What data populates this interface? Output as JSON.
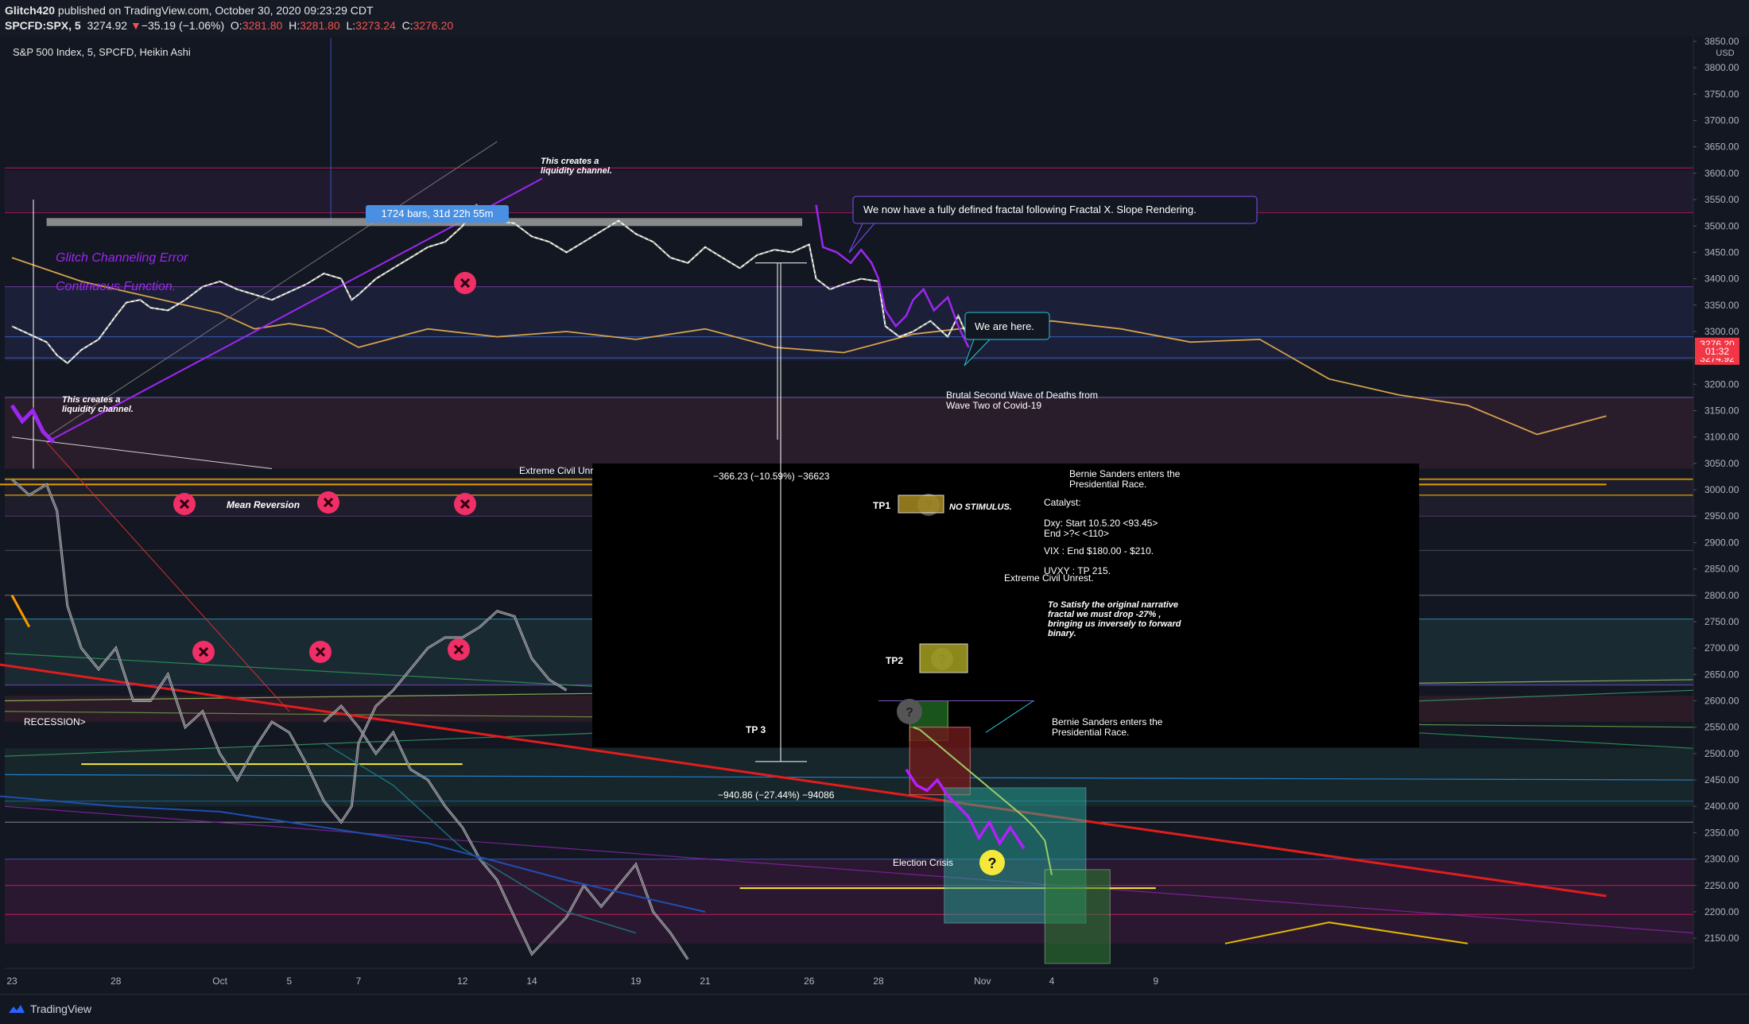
{
  "header": {
    "author": "Glitch420",
    "published_text": "published on TradingView.com, October 30, 2020 09:23:29 CDT",
    "symbol": "SPCFD:SPX, 5",
    "last": "3274.92",
    "change": "−35.19 (−1.06%)",
    "open_label": "O:",
    "open": "3281.80",
    "high_label": "H:",
    "high": "3281.80",
    "low_label": "L:",
    "low": "3273.24",
    "close_label": "C:",
    "close": "3276.20"
  },
  "footer": {
    "brand": "TradingView"
  },
  "colors": {
    "background": "#131722",
    "candles": "#f0f0f0",
    "purple": "#9c27f0",
    "orange": "#d4a24c",
    "red_line": "#e11d1d",
    "yellow": "#f5e83a",
    "marker": "#ef2f66"
  },
  "chart_data": {
    "type": "line",
    "title": "S&P 500 Index, 5, SPCFD, Heikin Ashi",
    "currency": "USD",
    "y_ticks": [
      3850,
      3800,
      3750,
      3700,
      3650,
      3600,
      3550,
      3500,
      3450,
      3400,
      3350,
      3300,
      3250,
      3200,
      3150,
      3100,
      3050,
      3000,
      2950,
      2900,
      2850,
      2800,
      2750,
      2700,
      2650,
      2600,
      2550,
      2500,
      2450,
      2400,
      2350,
      2300,
      2250,
      2200,
      2150
    ],
    "ylim": [
      2135,
      3870
    ],
    "x_ticks": [
      {
        "label": "23",
        "day": 0
      },
      {
        "label": "28",
        "day": 3
      },
      {
        "label": "Oct",
        "day": 6
      },
      {
        "label": "5",
        "day": 8
      },
      {
        "label": "7",
        "day": 10
      },
      {
        "label": "12",
        "day": 13
      },
      {
        "label": "14",
        "day": 15
      },
      {
        "label": "19",
        "day": 18
      },
      {
        "label": "21",
        "day": 20
      },
      {
        "label": "26",
        "day": 23
      },
      {
        "label": "28",
        "day": 25
      },
      {
        "label": "Nov",
        "day": 28
      },
      {
        "label": "4",
        "day": 30
      },
      {
        "label": "9",
        "day": 33
      }
    ],
    "price_badges": [
      {
        "text": "3276.20",
        "value": 3276.2
      },
      {
        "text": "3274.92",
        "value": 3249
      },
      {
        "text": "01:32",
        "value": 3262
      }
    ],
    "series": [
      {
        "name": "",
        "kind": "candles",
        "points": [
          [
            0,
            3310
          ],
          [
            0.5,
            3295
          ],
          [
            1,
            3280
          ],
          [
            1.3,
            3255
          ],
          [
            1.6,
            3240
          ],
          [
            2,
            3265
          ],
          [
            2.5,
            3285
          ],
          [
            3,
            3330
          ],
          [
            3.3,
            3355
          ],
          [
            3.7,
            3360
          ],
          [
            4,
            3345
          ],
          [
            4.5,
            3340
          ],
          [
            5,
            3360
          ],
          [
            5.5,
            3385
          ],
          [
            6,
            3395
          ],
          [
            6.5,
            3380
          ],
          [
            7,
            3370
          ],
          [
            7.5,
            3360
          ],
          [
            8,
            3375
          ],
          [
            8.5,
            3390
          ],
          [
            9,
            3410
          ],
          [
            9.5,
            3400
          ],
          [
            9.8,
            3360
          ],
          [
            10,
            3370
          ],
          [
            10.5,
            3400
          ],
          [
            11,
            3420
          ],
          [
            11.5,
            3440
          ],
          [
            12,
            3460
          ],
          [
            12.5,
            3470
          ],
          [
            13,
            3500
          ],
          [
            13.4,
            3540
          ],
          [
            13.7,
            3525
          ],
          [
            14,
            3510
          ],
          [
            14.5,
            3505
          ],
          [
            15,
            3480
          ],
          [
            15.5,
            3470
          ],
          [
            16,
            3450
          ],
          [
            16.5,
            3470
          ],
          [
            17,
            3490
          ],
          [
            17.5,
            3510
          ],
          [
            18,
            3485
          ],
          [
            18.5,
            3470
          ],
          [
            19,
            3440
          ],
          [
            19.5,
            3430
          ],
          [
            20,
            3460
          ],
          [
            20.5,
            3440
          ],
          [
            21,
            3420
          ],
          [
            21.5,
            3445
          ],
          [
            22,
            3455
          ],
          [
            22.5,
            3450
          ],
          [
            23,
            3465
          ],
          [
            23.2,
            3400
          ],
          [
            23.6,
            3380
          ],
          [
            24,
            3390
          ],
          [
            24.5,
            3400
          ],
          [
            25,
            3395
          ],
          [
            25.2,
            3310
          ],
          [
            25.6,
            3290
          ],
          [
            26,
            3300
          ],
          [
            26.5,
            3320
          ],
          [
            27,
            3290
          ],
          [
            27.3,
            3330
          ],
          [
            27.6,
            3285
          ]
        ]
      },
      {
        "name": "",
        "kind": "purple_projection",
        "points": [
          [
            23.2,
            3540
          ],
          [
            23.4,
            3460
          ],
          [
            23.8,
            3450
          ],
          [
            24.2,
            3430
          ],
          [
            24.5,
            3455
          ],
          [
            24.8,
            3430
          ],
          [
            25,
            3400
          ],
          [
            25.2,
            3340
          ],
          [
            25.5,
            3310
          ],
          [
            25.8,
            3330
          ],
          [
            26,
            3360
          ],
          [
            26.3,
            3380
          ],
          [
            26.6,
            3340
          ],
          [
            27,
            3365
          ],
          [
            27.3,
            3310
          ],
          [
            27.6,
            3270
          ]
        ]
      },
      {
        "name": "",
        "kind": "orange_ma",
        "points": [
          [
            0,
            3440
          ],
          [
            2,
            3395
          ],
          [
            4,
            3365
          ],
          [
            6,
            3335
          ],
          [
            7,
            3305
          ],
          [
            8,
            3315
          ],
          [
            9,
            3305
          ],
          [
            10,
            3270
          ],
          [
            12,
            3305
          ],
          [
            14,
            3290
          ],
          [
            16,
            3300
          ],
          [
            18,
            3285
          ],
          [
            20,
            3305
          ],
          [
            22,
            3270
          ],
          [
            24,
            3260
          ],
          [
            26,
            3295
          ],
          [
            28,
            3310
          ],
          [
            30,
            3320
          ],
          [
            32,
            3305
          ],
          [
            34,
            3280
          ],
          [
            36,
            3285
          ],
          [
            38,
            3210
          ],
          [
            40,
            3180
          ],
          [
            42,
            3160
          ],
          [
            44,
            3105
          ],
          [
            46,
            3140
          ]
        ]
      },
      {
        "name": "",
        "kind": "fractal_ghost",
        "points": [
          [
            0,
            3020
          ],
          [
            0.5,
            2990
          ],
          [
            1,
            3010
          ],
          [
            1.3,
            2960
          ],
          [
            1.6,
            2780
          ],
          [
            2,
            2700
          ],
          [
            2.5,
            2660
          ],
          [
            3,
            2700
          ],
          [
            3.5,
            2600
          ],
          [
            4,
            2600
          ],
          [
            4.5,
            2650
          ],
          [
            5,
            2550
          ],
          [
            5.5,
            2580
          ],
          [
            6,
            2500
          ],
          [
            6.5,
            2450
          ],
          [
            7,
            2510
          ],
          [
            7.5,
            2560
          ],
          [
            8,
            2540
          ],
          [
            8.5,
            2480
          ],
          [
            9,
            2410
          ],
          [
            9.5,
            2370
          ],
          [
            9.8,
            2400
          ],
          [
            10,
            2520
          ],
          [
            10.5,
            2590
          ],
          [
            11,
            2620
          ],
          [
            11.5,
            2660
          ],
          [
            12,
            2700
          ],
          [
            12.5,
            2720
          ],
          [
            13,
            2720
          ],
          [
            13.5,
            2740
          ],
          [
            14,
            2770
          ],
          [
            14.5,
            2760
          ],
          [
            15,
            2680
          ],
          [
            15.5,
            2640
          ],
          [
            16,
            2620
          ]
        ]
      },
      {
        "name": "",
        "kind": "fractal_lower",
        "points": [
          [
            9,
            2560
          ],
          [
            9.5,
            2590
          ],
          [
            10,
            2550
          ],
          [
            10.5,
            2500
          ],
          [
            11,
            2540
          ],
          [
            11.5,
            2470
          ],
          [
            12,
            2450
          ],
          [
            12.5,
            2400
          ],
          [
            13,
            2360
          ],
          [
            13.5,
            2300
          ],
          [
            14,
            2260
          ],
          [
            14.5,
            2190
          ],
          [
            15,
            2120
          ],
          [
            16,
            2190
          ],
          [
            16.5,
            2250
          ],
          [
            17,
            2210
          ],
          [
            17.5,
            2250
          ],
          [
            18,
            2290
          ],
          [
            18.5,
            2200
          ],
          [
            19,
            2160
          ],
          [
            19.5,
            2110
          ]
        ]
      },
      {
        "name": "",
        "kind": "purple_drop",
        "points": [
          [
            25.8,
            2470
          ],
          [
            26.1,
            2440
          ],
          [
            26.4,
            2430
          ],
          [
            26.7,
            2450
          ],
          [
            27,
            2420
          ],
          [
            27.3,
            2400
          ],
          [
            27.6,
            2380
          ],
          [
            27.9,
            2340
          ],
          [
            28.2,
            2370
          ],
          [
            28.5,
            2330
          ],
          [
            28.8,
            2360
          ],
          [
            29,
            2340
          ],
          [
            29.2,
            2320
          ]
        ]
      },
      {
        "name": "",
        "kind": "green_drop",
        "points": [
          [
            26,
            2550
          ],
          [
            26.2,
            2545
          ],
          [
            29.2,
            2380
          ],
          [
            29.5,
            2360
          ],
          [
            29.8,
            2335
          ],
          [
            30,
            2270
          ]
        ]
      }
    ],
    "lines": [
      {
        "kind": "red_trend",
        "from": [
          -0.5,
          2670
        ],
        "to": [
          46,
          2230
        ]
      },
      {
        "kind": "purple_channel",
        "from": [
          1,
          3090
        ],
        "to": [
          15.3,
          3590
        ]
      },
      {
        "kind": "mean_reversion",
        "from": [
          -0.5,
          3010
        ],
        "to": [
          46,
          3010
        ]
      }
    ],
    "annotations": {
      "bars_badge": "1724 bars, 31d 22h 55m",
      "glitch1": "Glitch Channeling Error",
      "glitch2": "Continuous Function.",
      "liquidity_top": "This creates a\nliquidity channel.",
      "liquidity_left": "This creates a\nliquidity channel.",
      "fractal_callout": "We now have a fully defined fractal following Fractal X. Slope Rendering.",
      "we_are_here": "We are here.",
      "second_wave": "Brutal Second Wave of Deaths from\nWave Two of Covid-19",
      "mean_reversion": "Mean Reversion",
      "extreme_unrest_cut": "Extreme Civil Unr",
      "recession": "RECESSION>",
      "measure_top": "−366.23 (−10.59%) −36623",
      "measure_bottom": "−940.86 (−27.44%) −94086",
      "bernie_top": "Bernie Sanders enters the\nPresidential Race.",
      "tp1": "TP1",
      "no_stimulus": "NO STIMULUS.",
      "catalyst": "Catalyst:",
      "dxy": "Dxy: Start 10.5.20 <93.45>\nEnd >?< <110>",
      "vix": "VIX : End $180.00 - $210.",
      "uvxy": "UVXY : TP 215.",
      "extreme_unrest": "Extreme Civil Unrest.",
      "satisfy": "To Satisfy the original narrative\nfractal we must drop -27% ,\nbringing us inversely to forward\nbinary.",
      "tp2": "TP2",
      "tp3": "TP 3",
      "bernie_bottom": "Bernie Sanders enters the\nPresidential Race.",
      "election_crisis": "Election Crisis",
      "question": "?"
    }
  }
}
